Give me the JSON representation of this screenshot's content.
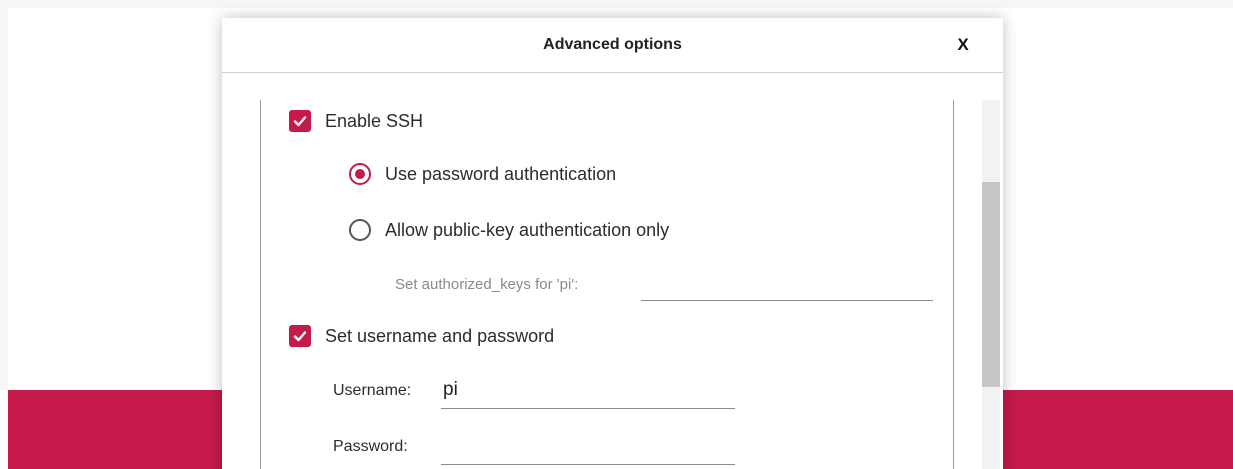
{
  "dialog": {
    "title": "Advanced options",
    "close_label": "X"
  },
  "ssh": {
    "enable_label": "Enable SSH",
    "enabled": true,
    "auth_options": [
      {
        "label": "Use password authentication",
        "selected": true
      },
      {
        "label": "Allow public-key authentication only",
        "selected": false
      }
    ],
    "authorized_keys_label": "Set authorized_keys for 'pi':",
    "authorized_keys_value": ""
  },
  "credentials": {
    "set_label": "Set username and password",
    "enabled": true,
    "username_label": "Username:",
    "username_value": "pi",
    "password_label": "Password:",
    "password_value": ""
  },
  "colors": {
    "accent": "#c51a4a",
    "band": "#c51a4a"
  }
}
